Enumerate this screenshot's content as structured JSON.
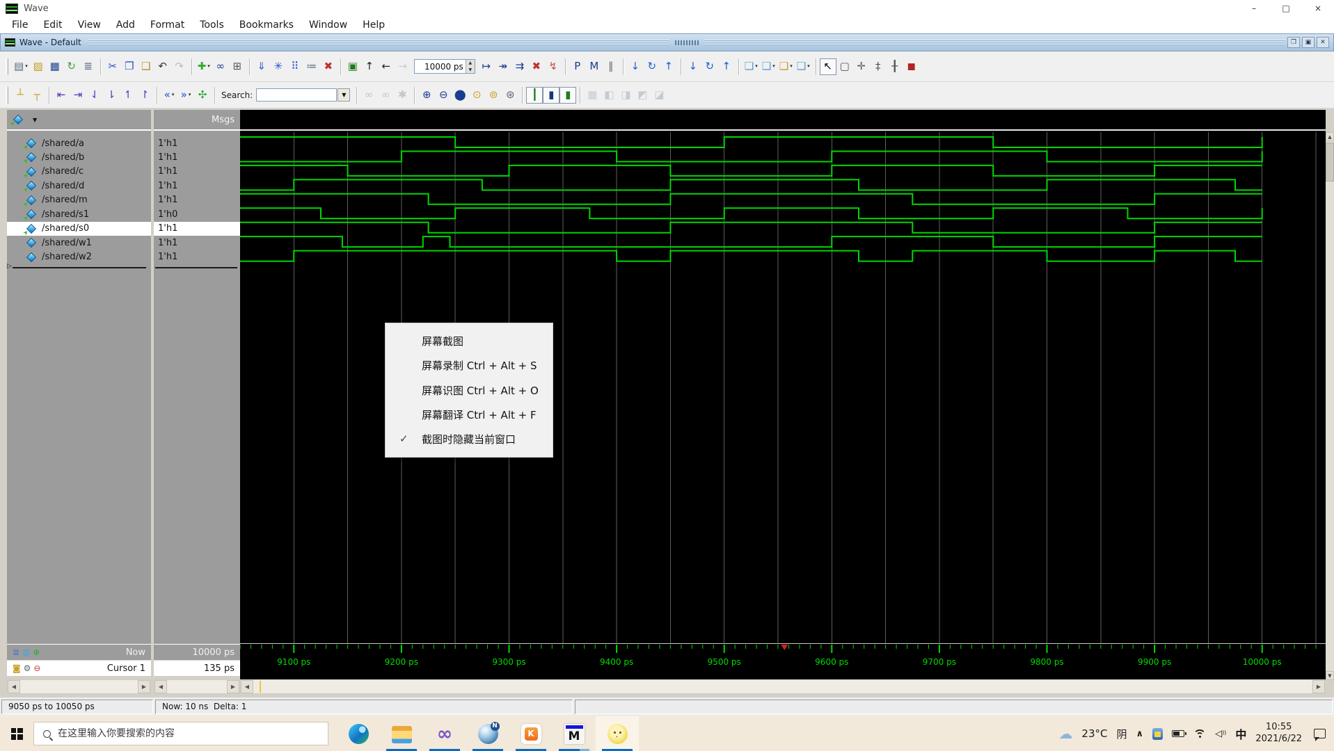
{
  "window": {
    "title": "Wave"
  },
  "menubar": [
    "File",
    "Edit",
    "View",
    "Add",
    "Format",
    "Tools",
    "Bookmarks",
    "Window",
    "Help"
  ],
  "panel": {
    "title": "Wave - Default"
  },
  "run_length": "10000 ps",
  "search": {
    "label": "Search:",
    "value": ""
  },
  "columns": {
    "msgs": "Msgs"
  },
  "toolbar1": [
    [
      {
        "n": "new-file-button",
        "g": "▤",
        "c": "#5a6a7a",
        "dd": true
      },
      {
        "n": "open-file-button",
        "g": "▨",
        "c": "#c79a1f"
      },
      {
        "n": "save-button",
        "g": "▦",
        "c": "#1a3d8f"
      },
      {
        "n": "reload-button",
        "g": "↻",
        "c": "#3f9e3f"
      },
      {
        "n": "print-button",
        "g": "≣",
        "c": "#5a6a7a"
      }
    ],
    [
      {
        "n": "cut-button",
        "g": "✂",
        "c": "#2b4fd4"
      },
      {
        "n": "copy-button",
        "g": "❐",
        "c": "#2b4fd4"
      },
      {
        "n": "paste-button",
        "g": "❑",
        "c": "#b58a2a"
      },
      {
        "n": "undo-button",
        "g": "↶",
        "c": "#333333"
      },
      {
        "n": "redo-button",
        "g": "↷",
        "c": "#777777",
        "gray": true
      }
    ],
    [
      {
        "n": "add-selected-button",
        "g": "✚",
        "c": "#2faa2f",
        "dd": true
      },
      {
        "n": "find-button",
        "g": "∞",
        "c": "#223a8f"
      },
      {
        "n": "goto-bookmark-button",
        "g": "⊞",
        "c": "#555555"
      }
    ],
    [
      {
        "n": "log-signals-button",
        "g": "⇓",
        "c": "#2b4fd4"
      },
      {
        "n": "virtual-signal-button",
        "g": "✳",
        "c": "#2b4fd4"
      },
      {
        "n": "memory-list-button",
        "g": "⠿",
        "c": "#2b4fd4"
      },
      {
        "n": "show-drivers-button",
        "g": "≔",
        "c": "#556677"
      },
      {
        "n": "end-simulation-button",
        "g": "✖",
        "c": "#c03030"
      }
    ],
    [
      {
        "n": "restart-button",
        "g": "▣",
        "c": "#1f7a1f"
      },
      {
        "n": "environment-up-button",
        "g": "↑",
        "c": "#222222"
      },
      {
        "n": "environment-back-button",
        "g": "←",
        "c": "#222222"
      },
      {
        "n": "environment-forward-button",
        "g": "→",
        "c": "#999999",
        "gray": true
      },
      {
        "type": "spinner"
      },
      {
        "n": "run-button",
        "g": "↦",
        "c": "#1a3d8f"
      },
      {
        "n": "run-continue-button",
        "g": "↠",
        "c": "#1a3d8f"
      },
      {
        "n": "run-all-button",
        "g": "⇉",
        "c": "#1a3d8f"
      },
      {
        "n": "break-button",
        "g": "✖",
        "c": "#c03030"
      },
      {
        "n": "stop-sim-button",
        "g": "↯",
        "c": "#c05050"
      }
    ],
    [
      {
        "n": "performance-profile-button",
        "g": "P",
        "c": "#1a3d8f"
      },
      {
        "n": "memory-profile-button",
        "g": "M",
        "c": "#1a3d8f"
      },
      {
        "n": "pause-drawing-button",
        "g": "∥",
        "c": "#666666"
      }
    ],
    [
      {
        "n": "scroll-last-button",
        "g": "↓",
        "c": "#1d5fd4"
      },
      {
        "n": "reload-wave-button",
        "g": "↻",
        "c": "#1d5fd4"
      },
      {
        "n": "scroll-first-button",
        "g": "↑",
        "c": "#1d5fd4"
      }
    ],
    [
      {
        "n": "jump-down-button",
        "g": "↓",
        "c": "#1d5fd4"
      },
      {
        "n": "refresh-wave-button",
        "g": "↻",
        "c": "#1d5fd4"
      },
      {
        "n": "jump-up-button",
        "g": "↑",
        "c": "#1d5fd4"
      }
    ],
    [
      {
        "n": "toggle-leaf-names-button",
        "g": "❏",
        "c": "#5b9bd5",
        "dd": true
      },
      {
        "n": "select-wave-view-button",
        "g": "❏",
        "c": "#5b9bd5",
        "dd": true
      },
      {
        "n": "combine-signals-button",
        "g": "❏",
        "c": "#c79a1f",
        "dd": true
      },
      {
        "n": "group-signals-button",
        "g": "❏",
        "c": "#5b9bd5",
        "dd": true
      }
    ],
    [
      {
        "n": "select-mode-button",
        "g": "↖",
        "c": "#000000",
        "framed": true
      },
      {
        "n": "zoom-mode-button",
        "g": "▢",
        "c": "#555555"
      },
      {
        "n": "pan-mode-button",
        "g": "✛",
        "c": "#555555"
      },
      {
        "n": "edit-mode-button",
        "g": "‡",
        "c": "#555555"
      },
      {
        "n": "crosshair-mode-button",
        "g": "╂",
        "c": "#555555"
      },
      {
        "n": "stop-draw-button",
        "g": "◼",
        "c": "#b22222"
      }
    ]
  ],
  "toolbar2": [
    [
      {
        "n": "insert-cursor-button",
        "g": "┴",
        "c": "#c9a227"
      },
      {
        "n": "delete-cursor-button",
        "g": "┬",
        "c": "#c9a227"
      }
    ],
    [
      {
        "n": "prev-transition-button",
        "g": "⇤",
        "c": "#5a2fb8"
      },
      {
        "n": "next-transition-button",
        "g": "⇥",
        "c": "#5a2fb8"
      },
      {
        "n": "prev-falling-edge-button",
        "g": "⇃",
        "c": "#5a2fb8"
      },
      {
        "n": "next-falling-edge-button",
        "g": "⇂",
        "c": "#5a2fb8"
      },
      {
        "n": "prev-rising-edge-button",
        "g": "↿",
        "c": "#5a2fb8"
      },
      {
        "n": "next-rising-edge-button",
        "g": "↾",
        "c": "#5a2fb8"
      }
    ],
    [
      {
        "n": "collapse-left-button",
        "g": "«",
        "c": "#2b4fd4",
        "dd": true
      },
      {
        "n": "collapse-right-button",
        "g": "»",
        "c": "#2b4fd4",
        "dd": true
      },
      {
        "n": "expand-all-button",
        "g": "✣",
        "c": "#2faa2f"
      }
    ],
    [
      {
        "type": "search"
      }
    ],
    [
      {
        "n": "search-reverse-button",
        "g": "∞",
        "c": "#888899",
        "gray": true
      },
      {
        "n": "search-forward-button",
        "g": "∞",
        "c": "#888899",
        "gray": true
      },
      {
        "n": "search-options-button",
        "g": "✱",
        "c": "#888899",
        "gray": true
      }
    ],
    [
      {
        "n": "zoom-in-button",
        "g": "⊕",
        "c": "#1a3d8f"
      },
      {
        "n": "zoom-out-button",
        "g": "⊖",
        "c": "#1a3d8f"
      },
      {
        "n": "zoom-full-button",
        "g": "⬤",
        "c": "#1a3d8f"
      },
      {
        "n": "zoom-cursor-button",
        "g": "⊙",
        "c": "#c9a227"
      },
      {
        "n": "zoom-between-cursors-button",
        "g": "⊚",
        "c": "#c9a227"
      },
      {
        "n": "zoom-range-button",
        "g": "⊛",
        "c": "#666677"
      }
    ],
    [
      {
        "n": "waveform-line-view-button",
        "g": "┃",
        "c": "#1f7a1f",
        "framed": true
      },
      {
        "n": "waveform-event-view-button",
        "g": "▮",
        "c": "#16357f",
        "framed": true
      },
      {
        "n": "waveform-density-view-button",
        "g": "▮",
        "c": "#1f7a1f",
        "framed": true
      }
    ],
    [
      {
        "n": "compare-options-button",
        "g": "▦",
        "c": "#8899aa",
        "gray": true
      },
      {
        "n": "edge-tolerance-1-button",
        "g": "◧",
        "c": "#8899aa",
        "gray": true
      },
      {
        "n": "edge-tolerance-2-button",
        "g": "◨",
        "c": "#8899aa",
        "gray": true
      },
      {
        "n": "edge-tolerance-3-button",
        "g": "◩",
        "c": "#8899aa",
        "gray": true
      },
      {
        "n": "edge-tolerance-4-button",
        "g": "◪",
        "c": "#8899aa",
        "gray": true
      }
    ]
  ],
  "signals": [
    {
      "name": "/shared/a",
      "value": "1'h1",
      "icon": "input"
    },
    {
      "name": "/shared/b",
      "value": "1'h1",
      "icon": "input"
    },
    {
      "name": "/shared/c",
      "value": "1'h1",
      "icon": "input"
    },
    {
      "name": "/shared/d",
      "value": "1'h1",
      "icon": "input"
    },
    {
      "name": "/shared/m",
      "value": "1'h1",
      "icon": "input"
    },
    {
      "name": "/shared/s1",
      "value": "1'h0",
      "icon": "input"
    },
    {
      "name": "/shared/s0",
      "value": "1'h1",
      "icon": "input",
      "selected": true
    },
    {
      "name": "/shared/w1",
      "value": "1'h1",
      "icon": "signal"
    },
    {
      "name": "/shared/w2",
      "value": "1'h1",
      "icon": "signal"
    }
  ],
  "chart_data": {
    "type": "digital-waveform",
    "time_unit": "ps",
    "view_start": 9050,
    "view_end": 10050,
    "data_end": 10000,
    "grid_interval": 50,
    "tick_interval": 10,
    "label_interval": 100,
    "wave_color": "#00d800",
    "grid_color": "#5f5f5f",
    "marker_time": 9556,
    "marker_color": "#cc2222",
    "tick_labels": [
      "9100 ps",
      "9200 ps",
      "9300 ps",
      "9400 ps",
      "9500 ps",
      "9600 ps",
      "9700 ps",
      "9800 ps",
      "9900 ps",
      "10000 ps"
    ],
    "signals": [
      {
        "name": "/shared/a",
        "initial": 1,
        "toggles": [
          9250,
          9500,
          9750,
          10000
        ]
      },
      {
        "name": "/shared/b",
        "initial": 0,
        "toggles": [
          9200,
          9400,
          9600,
          9800,
          10000
        ]
      },
      {
        "name": "/shared/c",
        "initial": 1,
        "toggles": [
          9150,
          9300,
          9450,
          9600,
          9750,
          9900
        ]
      },
      {
        "name": "/shared/d",
        "initial": 0,
        "toggles": [
          9100,
          9275,
          9450,
          9625,
          9800,
          9975
        ]
      },
      {
        "name": "/shared/m",
        "initial": 1,
        "toggles": [
          9225,
          9450,
          9675,
          9900
        ]
      },
      {
        "name": "/shared/s1",
        "initial": 1,
        "toggles": [
          9125,
          9250,
          9375,
          9500,
          9625,
          9750,
          9875,
          10000
        ]
      },
      {
        "name": "/shared/s0",
        "initial": 1,
        "toggles": [
          9225,
          9450,
          9675,
          9900
        ]
      },
      {
        "name": "/shared/w1",
        "initial": 1,
        "toggles": [
          9145,
          9220,
          9245,
          9600,
          9750,
          9900
        ]
      },
      {
        "name": "/shared/w2",
        "initial": 0,
        "toggles": [
          9100,
          9400,
          9450,
          9625,
          9675,
          9800,
          9900,
          9975
        ]
      }
    ]
  },
  "cursors": {
    "now_label": "Now",
    "now_value": "10000 ps",
    "cursor_label": "Cursor 1",
    "cursor_value": "135 ps"
  },
  "statusbar": {
    "range": "9050 ps to 10050 ps",
    "now": "Now: 10 ns  Delta: 1"
  },
  "context_menu": {
    "items": [
      {
        "label": "屏幕截图",
        "checked": false
      },
      {
        "label": "屏幕录制 Ctrl + Alt + S",
        "checked": false
      },
      {
        "label": "屏幕识图 Ctrl + Alt + O",
        "checked": false
      },
      {
        "label": "屏幕翻译 Ctrl + Alt + F",
        "checked": false
      },
      {
        "label": "截图时隐藏当前窗口",
        "checked": true
      }
    ]
  },
  "taskbar": {
    "search_placeholder": "在这里输入你要搜索的内容",
    "apps": [
      {
        "name": "edge",
        "open": false,
        "active": false
      },
      {
        "name": "file-explorer",
        "open": true,
        "active": false
      },
      {
        "name": "visual-studio",
        "open": true,
        "active": false
      },
      {
        "name": "globe-app",
        "open": true,
        "active": false
      },
      {
        "name": "k-box-app",
        "open": true,
        "active": false
      },
      {
        "name": "m-app",
        "open": true,
        "active": false,
        "twotone": true
      },
      {
        "name": "spongebob-app",
        "open": true,
        "active": true
      }
    ],
    "tray": {
      "temperature": "23°C",
      "weather": "阴",
      "ime": "中",
      "time": "10:55",
      "date": "2021/6/22"
    }
  }
}
